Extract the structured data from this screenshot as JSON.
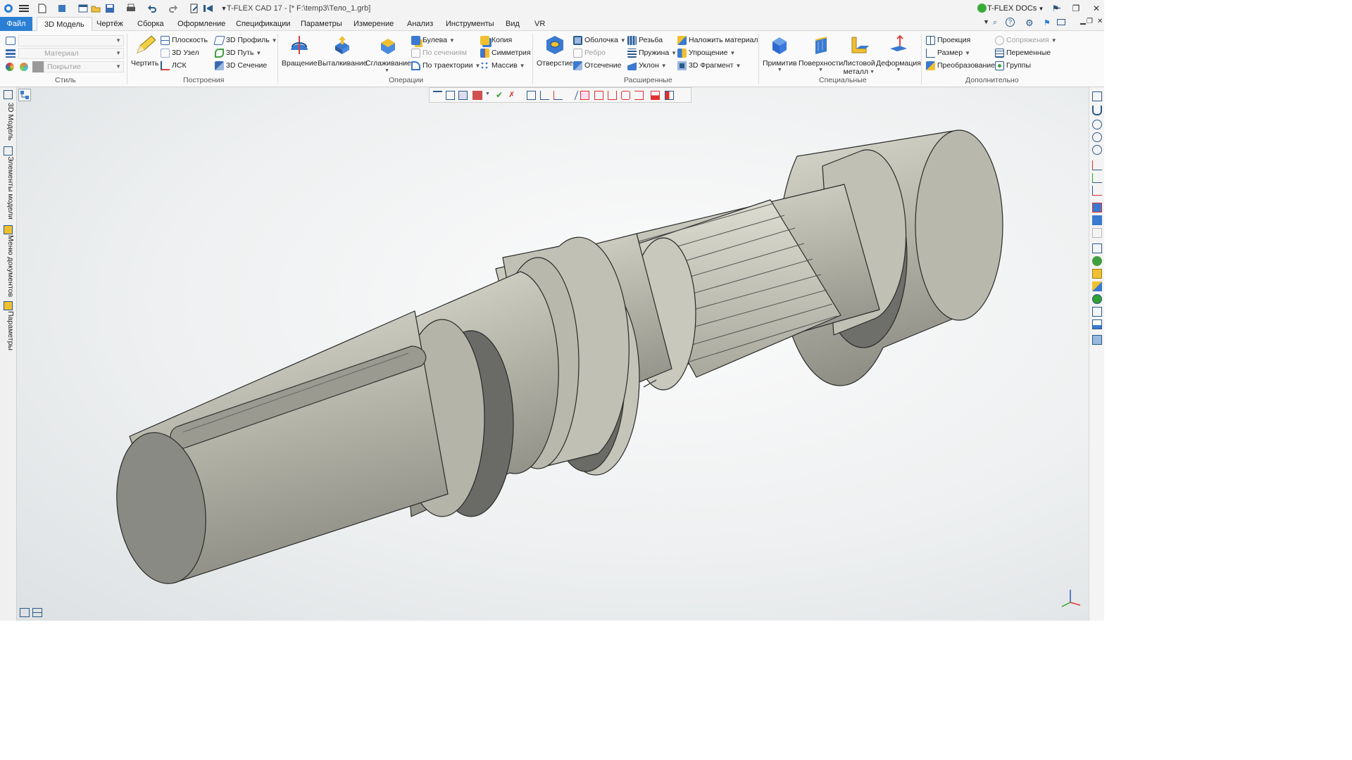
{
  "titlebar": {
    "app_title": "T-FLEX CAD 17 - [* F:\\temp3\\Тело_1.grb]",
    "docs_label": "T-FLEX DOCs"
  },
  "tabs": [
    "Файл",
    "3D Модель",
    "Чертёж",
    "Сборка",
    "Оформление",
    "Спецификации",
    "Параметры",
    "Измерение",
    "Анализ",
    "Инструменты",
    "Вид",
    "VR"
  ],
  "style_group": {
    "material_placeholder": "Материал",
    "coating_placeholder": "Покрытие",
    "label": "Стиль"
  },
  "build_group": {
    "draw": "Чертить",
    "plane": "Плоскость",
    "node3d": "3D Узел",
    "lsk": "ЛСК",
    "profile3d": "3D Профиль",
    "path3d": "3D Путь",
    "section3d": "3D Сечение",
    "label": "Построения"
  },
  "ops_group": {
    "rotation": "Вращение",
    "extrude": "Выталкивание",
    "smooth": "Сглаживание",
    "boolean": "Булева",
    "by_sections": "По сечениям",
    "by_path": "По траектории",
    "copy": "Копия",
    "symmetry": "Симметрия",
    "array": "Массив",
    "label": "Операции"
  },
  "ext_group": {
    "hole": "Отверстие",
    "shell": "Оболочка",
    "rib": "Ребро",
    "cut": "Отсечение",
    "thread": "Резьба",
    "spring": "Пружина",
    "slope": "Уклон",
    "apply_material": "Наложить материал",
    "simplify": "Упрощение",
    "fragment3d": "3D Фрагмент",
    "label": "Расширенные"
  },
  "special_group": {
    "primitive": "Примитив",
    "surfaces": "Поверхности",
    "sheet_metal_1": "Листовой",
    "sheet_metal_2": "металл",
    "deformation": "Деформация",
    "label": "Специальные"
  },
  "extra_group": {
    "projection": "Проекция",
    "dimension": "Размер",
    "transform": "Преобразование",
    "mates": "Сопряжения",
    "variables": "Переменные",
    "groups": "Группы",
    "label": "Дополнительно"
  },
  "left_panel_tabs": [
    "3D Модель",
    "Элементы модели",
    "Меню документов",
    "Параметры"
  ],
  "colors": {
    "accent": "#2a7fd4",
    "part_body": "#c2c2b6",
    "part_shade": "#9a9a90",
    "part_dark": "#6a6a66"
  }
}
